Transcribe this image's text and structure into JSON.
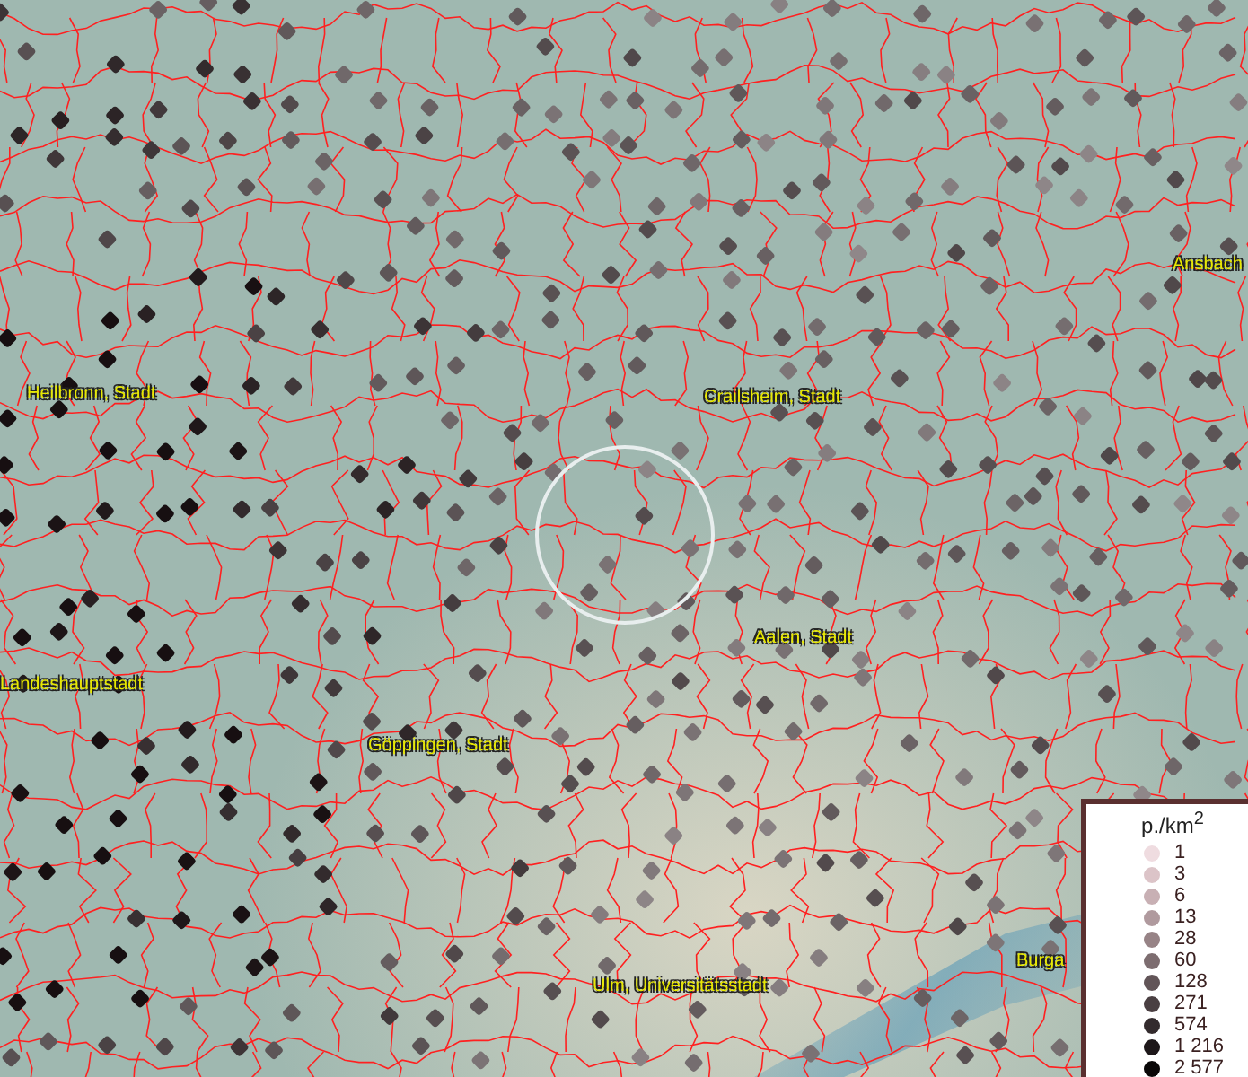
{
  "map_labels": [
    {
      "text": "Ansbach"
    },
    {
      "text": "Heilbronn, Stadt"
    },
    {
      "text": "Crailsheim, Stadt"
    },
    {
      "text": "Aalen, Stadt"
    },
    {
      "text": "Landeshauptstadt"
    },
    {
      "text": "Göppingen, Stadt"
    },
    {
      "text": "Burga"
    },
    {
      "text": "Ulm, Universitätsstadt"
    }
  ],
  "legend": {
    "title": "p./km$^{2}$",
    "items": [
      {
        "label": "1",
        "color": "#efdce0"
      },
      {
        "label": "3",
        "color": "#dcc4c8"
      },
      {
        "label": "6",
        "color": "#c8b0b4"
      },
      {
        "label": "13",
        "color": "#b09a9e"
      },
      {
        "label": "28",
        "color": "#978386"
      },
      {
        "label": "60",
        "color": "#7d6d70"
      },
      {
        "label": "128",
        "color": "#625558"
      },
      {
        "label": "271",
        "color": "#4a3f42"
      },
      {
        "label": "574",
        "color": "#332b2d"
      },
      {
        "label": "1 216",
        "color": "#1e181a"
      },
      {
        "label": "2 577",
        "color": "#0a0808"
      }
    ]
  }
}
